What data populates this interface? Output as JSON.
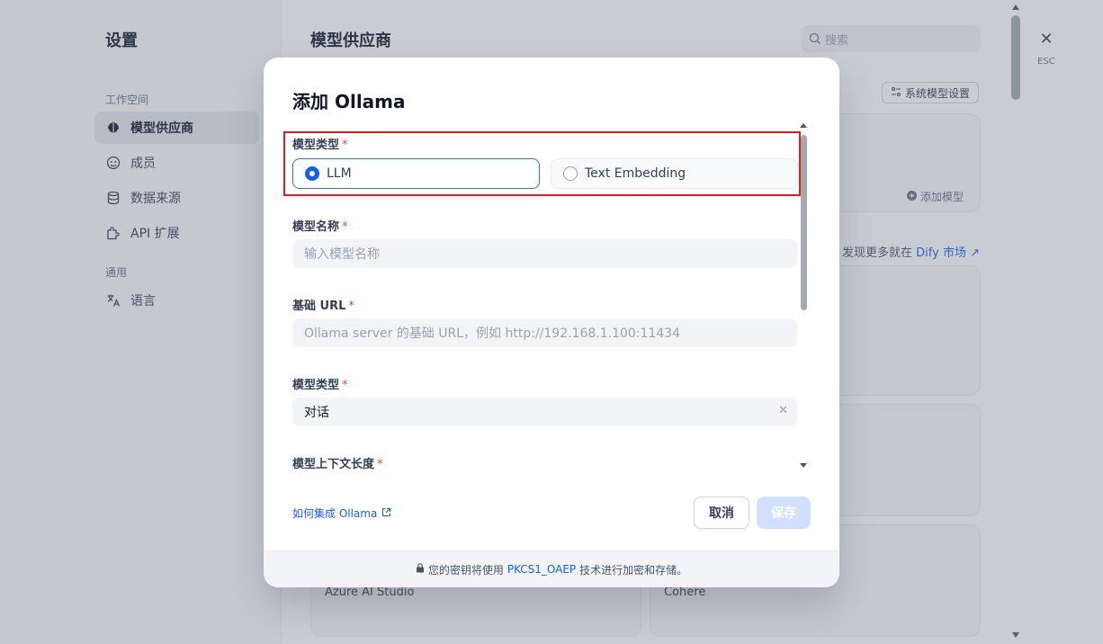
{
  "settings": {
    "title": "设置",
    "groups": {
      "workspace": "工作空间",
      "general": "通用"
    },
    "nav": [
      {
        "label": "模型供应商",
        "active": true
      },
      {
        "label": "成员"
      },
      {
        "label": "数据来源"
      },
      {
        "label": "API 扩展"
      },
      {
        "label": "语言"
      }
    ]
  },
  "main": {
    "title": "模型供应商",
    "search_placeholder": "搜索",
    "system_model_settings": "系统模型设置",
    "add_model": "添加模型",
    "discover_prefix": "发现更多就在",
    "discover_link": "Dify 市场 ↗",
    "card_labels": [
      "Azure AI Studio",
      "Cohere"
    ]
  },
  "close": {
    "symbol": "✕",
    "label": "ESC"
  },
  "modal": {
    "title": "添加 Ollama",
    "fields": {
      "model_kind": {
        "label": "模型类型",
        "options": [
          "LLM",
          "Text Embedding"
        ],
        "selected": "LLM"
      },
      "model_name": {
        "label": "模型名称",
        "placeholder": "输入模型名称"
      },
      "base_url": {
        "label": "基础 URL",
        "placeholder": "Ollama server 的基础 URL，例如 http://192.168.1.100:11434"
      },
      "completion_mode": {
        "label": "模型类型",
        "value": "对话"
      },
      "context_size": {
        "label": "模型上下文长度"
      }
    },
    "required_mark": "*",
    "help_link": "如何集成 Ollama",
    "cancel": "取消",
    "save": "保存",
    "footer": {
      "prefix": "您的密钥将使用",
      "highlight": "PKCS1_OAEP",
      "suffix": "技术进行加密和存储。"
    }
  },
  "colors": {
    "accent": "#155eef",
    "required": "#f04438",
    "highlight_border": "#e11d1d"
  }
}
